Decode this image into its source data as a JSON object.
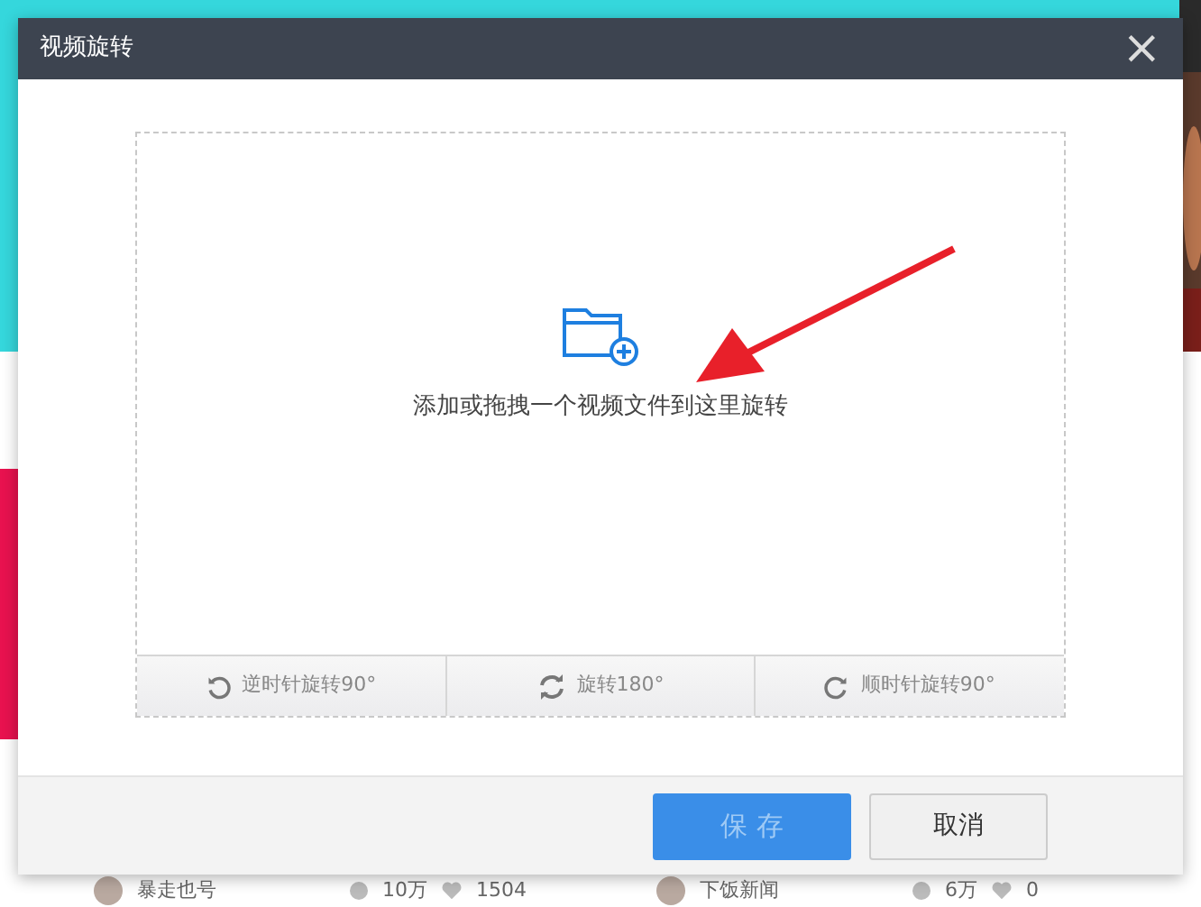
{
  "dialog": {
    "title": "视频旋转",
    "close": "×",
    "drop_hint": "添加或拖拽一个视频文件到这里旋转",
    "rotate_buttons": [
      {
        "kind": "ccw",
        "label": "逆时针旋转90°"
      },
      {
        "kind": "flip",
        "label": "旋转180°"
      },
      {
        "kind": "cw",
        "label": "顺时针旋转90°"
      }
    ],
    "save": {
      "label": "保 存",
      "disabled": true
    },
    "cancel": "取消"
  },
  "feed": [
    {
      "author": "暴走也号",
      "plays": "10万",
      "likes": "1504"
    },
    {
      "author": "下饭新闻",
      "plays": "6万",
      "likes": "0"
    }
  ]
}
